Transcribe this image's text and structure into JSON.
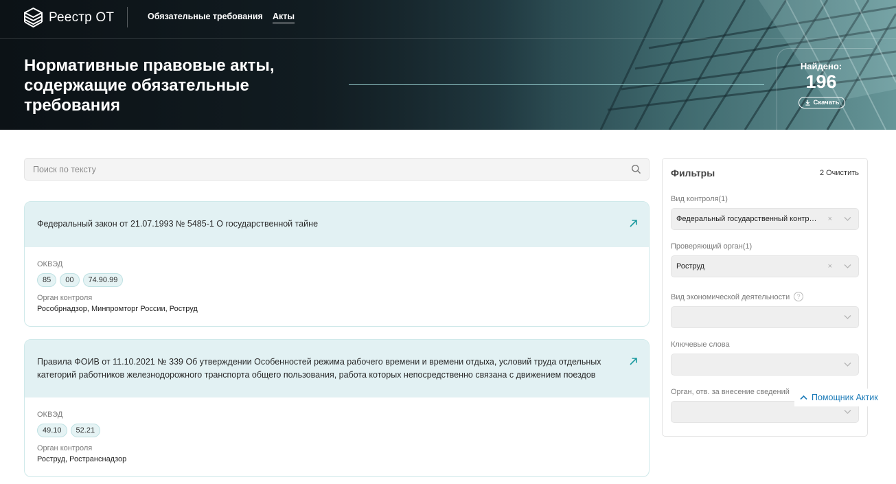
{
  "app": {
    "name": "Реестр ОТ"
  },
  "nav": {
    "items": [
      {
        "label": "Обязательные требования"
      },
      {
        "label": "Акты"
      }
    ]
  },
  "hero": {
    "title": "Нормативные правовые акты, содержащие обязательные требования",
    "found_label": "Найдено:",
    "found_count": "196",
    "download_label": "Скачать"
  },
  "search": {
    "placeholder": "Поиск по тексту"
  },
  "cards": [
    {
      "title": "Федеральный закон от 21.07.1993 № 5485-1 О государственной тайне",
      "okved_label": "ОКВЭД",
      "okved": [
        "85",
        "00",
        "74.90.99"
      ],
      "organ_label": "Орган контроля",
      "organ": "Рособрнадзор, Минпромторг России, Роструд"
    },
    {
      "title": "Правила ФОИВ от 11.10.2021 № 339 Об утверждении Особенностей режима рабочего времени и времени отдыха, условий труда отдельных категорий работников железнодорожного транспорта общего пользования, работа которых непосредственно связана с движением поездов",
      "okved_label": "ОКВЭД",
      "okved": [
        "49.10",
        "52.21"
      ],
      "organ_label": "Орган контроля",
      "organ": "Роструд, Ространснадзор"
    }
  ],
  "filters": {
    "title": "Фильтры",
    "clear_label": "2 Очистить",
    "fields": [
      {
        "label": "Вид контроля(1)",
        "value": "Федеральный государственный контроль (надзор) за соблюдением трудового законодательства"
      },
      {
        "label": "Проверяющий орган(1)",
        "value": "Роструд"
      },
      {
        "label": "Вид экономической деятельности",
        "value": ""
      },
      {
        "label": "Ключевые слова",
        "value": ""
      },
      {
        "label": "Орган, отв. за внесение сведений",
        "value": ""
      }
    ],
    "help_glyph": "?"
  },
  "assistant": {
    "label": "Помощник Актик"
  },
  "colors": {
    "accent": "#1a7ab8",
    "card_head": "#e2f1f3",
    "chip_border": "#bfe1e3",
    "link_icon": "#1b9aa0"
  }
}
